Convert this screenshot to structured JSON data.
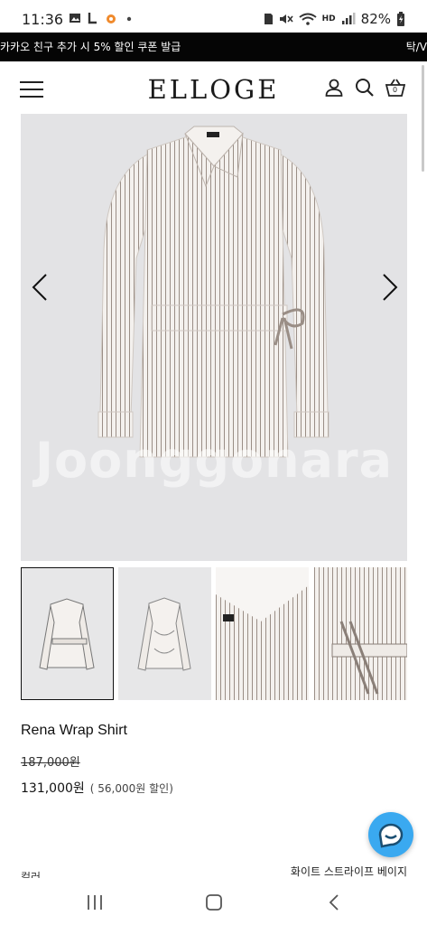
{
  "status_bar": {
    "time": "11:36",
    "battery": "82%",
    "network": "HD",
    "icons_left": [
      "gallery-icon",
      "app-l-icon",
      "flame-app-icon",
      "dot-icon"
    ],
    "icons_right": [
      "sd-card-icon",
      "mute-icon",
      "wifi-icon",
      "signal-icon",
      "battery-icon"
    ]
  },
  "promo": {
    "text": "카카오 친구 추가 시 5% 할인 쿠폰 발급",
    "tail": "탁/V"
  },
  "header": {
    "logo": "ELLOGE",
    "icons": [
      "menu-icon",
      "user-icon",
      "search-icon",
      "cart-icon"
    ],
    "cart_count": "0"
  },
  "gallery": {
    "watermark": "Joonggonara",
    "thumbnail_count": 4,
    "selected_index": 0
  },
  "product": {
    "name": "Rena Wrap Shirt",
    "original_price": "187,000원",
    "sale_price": "131,000원",
    "discount": "( 56,000원 할인)",
    "color_label": "컬러",
    "color_value": "화이트  스트라이프 베이지"
  },
  "colors": {
    "banner_bg": "#050505",
    "chat_fab": "#3aa9f0",
    "image_bg": "#e3e3e5"
  }
}
